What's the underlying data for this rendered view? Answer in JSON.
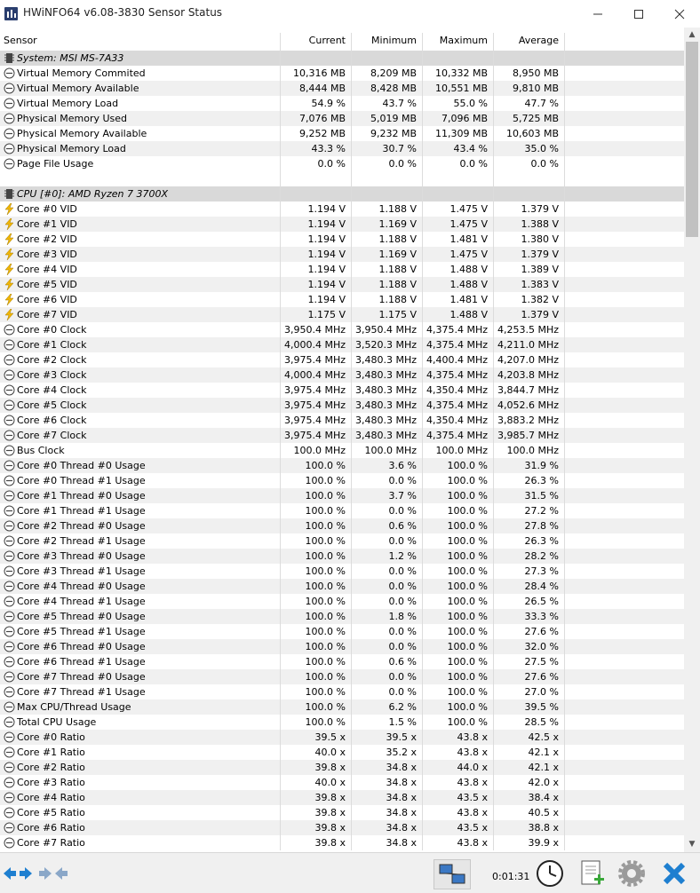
{
  "window": {
    "title": "HWiNFO64 v6.08-3830 Sensor Status"
  },
  "columns": {
    "sensor": "Sensor",
    "current": "Current",
    "minimum": "Minimum",
    "maximum": "Maximum",
    "average": "Average"
  },
  "rows": [
    {
      "type": "group",
      "name": "System: MSI MS-7A33"
    },
    {
      "type": "sensor",
      "icon": "gauge",
      "name": "Virtual Memory Commited",
      "cur": "10,316 MB",
      "min": "8,209 MB",
      "max": "10,332 MB",
      "avg": "8,950 MB"
    },
    {
      "type": "sensor",
      "icon": "gauge",
      "name": "Virtual Memory Available",
      "cur": "8,444 MB",
      "min": "8,428 MB",
      "max": "10,551 MB",
      "avg": "9,810 MB"
    },
    {
      "type": "sensor",
      "icon": "gauge",
      "name": "Virtual Memory Load",
      "cur": "54.9 %",
      "min": "43.7 %",
      "max": "55.0 %",
      "avg": "47.7 %"
    },
    {
      "type": "sensor",
      "icon": "gauge",
      "name": "Physical Memory Used",
      "cur": "7,076 MB",
      "min": "5,019 MB",
      "max": "7,096 MB",
      "avg": "5,725 MB"
    },
    {
      "type": "sensor",
      "icon": "gauge",
      "name": "Physical Memory Available",
      "cur": "9,252 MB",
      "min": "9,232 MB",
      "max": "11,309 MB",
      "avg": "10,603 MB"
    },
    {
      "type": "sensor",
      "icon": "gauge",
      "name": "Physical Memory Load",
      "cur": "43.3 %",
      "min": "30.7 %",
      "max": "43.4 %",
      "avg": "35.0 %"
    },
    {
      "type": "sensor",
      "icon": "gauge",
      "name": "Page File Usage",
      "cur": "0.0 %",
      "min": "0.0 %",
      "max": "0.0 %",
      "avg": "0.0 %"
    },
    {
      "type": "blank"
    },
    {
      "type": "group",
      "name": "CPU [#0]: AMD Ryzen 7 3700X"
    },
    {
      "type": "sensor",
      "icon": "bolt",
      "name": "Core #0 VID",
      "cur": "1.194 V",
      "min": "1.188 V",
      "max": "1.475 V",
      "avg": "1.379 V"
    },
    {
      "type": "sensor",
      "icon": "bolt",
      "name": "Core #1 VID",
      "cur": "1.194 V",
      "min": "1.169 V",
      "max": "1.475 V",
      "avg": "1.388 V"
    },
    {
      "type": "sensor",
      "icon": "bolt",
      "name": "Core #2 VID",
      "cur": "1.194 V",
      "min": "1.188 V",
      "max": "1.481 V",
      "avg": "1.380 V"
    },
    {
      "type": "sensor",
      "icon": "bolt",
      "name": "Core #3 VID",
      "cur": "1.194 V",
      "min": "1.169 V",
      "max": "1.475 V",
      "avg": "1.379 V"
    },
    {
      "type": "sensor",
      "icon": "bolt",
      "name": "Core #4 VID",
      "cur": "1.194 V",
      "min": "1.188 V",
      "max": "1.488 V",
      "avg": "1.389 V"
    },
    {
      "type": "sensor",
      "icon": "bolt",
      "name": "Core #5 VID",
      "cur": "1.194 V",
      "min": "1.188 V",
      "max": "1.488 V",
      "avg": "1.383 V"
    },
    {
      "type": "sensor",
      "icon": "bolt",
      "name": "Core #6 VID",
      "cur": "1.194 V",
      "min": "1.188 V",
      "max": "1.481 V",
      "avg": "1.382 V"
    },
    {
      "type": "sensor",
      "icon": "bolt",
      "name": "Core #7 VID",
      "cur": "1.175 V",
      "min": "1.175 V",
      "max": "1.488 V",
      "avg": "1.379 V"
    },
    {
      "type": "sensor",
      "icon": "gauge",
      "name": "Core #0 Clock",
      "cur": "3,950.4 MHz",
      "min": "3,950.4 MHz",
      "max": "4,375.4 MHz",
      "avg": "4,253.5 MHz"
    },
    {
      "type": "sensor",
      "icon": "gauge",
      "name": "Core #1 Clock",
      "cur": "4,000.4 MHz",
      "min": "3,520.3 MHz",
      "max": "4,375.4 MHz",
      "avg": "4,211.0 MHz"
    },
    {
      "type": "sensor",
      "icon": "gauge",
      "name": "Core #2 Clock",
      "cur": "3,975.4 MHz",
      "min": "3,480.3 MHz",
      "max": "4,400.4 MHz",
      "avg": "4,207.0 MHz"
    },
    {
      "type": "sensor",
      "icon": "gauge",
      "name": "Core #3 Clock",
      "cur": "4,000.4 MHz",
      "min": "3,480.3 MHz",
      "max": "4,375.4 MHz",
      "avg": "4,203.8 MHz"
    },
    {
      "type": "sensor",
      "icon": "gauge",
      "name": "Core #4 Clock",
      "cur": "3,975.4 MHz",
      "min": "3,480.3 MHz",
      "max": "4,350.4 MHz",
      "avg": "3,844.7 MHz"
    },
    {
      "type": "sensor",
      "icon": "gauge",
      "name": "Core #5 Clock",
      "cur": "3,975.4 MHz",
      "min": "3,480.3 MHz",
      "max": "4,375.4 MHz",
      "avg": "4,052.6 MHz"
    },
    {
      "type": "sensor",
      "icon": "gauge",
      "name": "Core #6 Clock",
      "cur": "3,975.4 MHz",
      "min": "3,480.3 MHz",
      "max": "4,350.4 MHz",
      "avg": "3,883.2 MHz"
    },
    {
      "type": "sensor",
      "icon": "gauge",
      "name": "Core #7 Clock",
      "cur": "3,975.4 MHz",
      "min": "3,480.3 MHz",
      "max": "4,375.4 MHz",
      "avg": "3,985.7 MHz"
    },
    {
      "type": "sensor",
      "icon": "gauge",
      "name": "Bus Clock",
      "cur": "100.0 MHz",
      "min": "100.0 MHz",
      "max": "100.0 MHz",
      "avg": "100.0 MHz"
    },
    {
      "type": "sensor",
      "icon": "gauge",
      "name": "Core #0 Thread #0 Usage",
      "cur": "100.0 %",
      "min": "3.6 %",
      "max": "100.0 %",
      "avg": "31.9 %"
    },
    {
      "type": "sensor",
      "icon": "gauge",
      "name": "Core #0 Thread #1 Usage",
      "cur": "100.0 %",
      "min": "0.0 %",
      "max": "100.0 %",
      "avg": "26.3 %"
    },
    {
      "type": "sensor",
      "icon": "gauge",
      "name": "Core #1 Thread #0 Usage",
      "cur": "100.0 %",
      "min": "3.7 %",
      "max": "100.0 %",
      "avg": "31.5 %"
    },
    {
      "type": "sensor",
      "icon": "gauge",
      "name": "Core #1 Thread #1 Usage",
      "cur": "100.0 %",
      "min": "0.0 %",
      "max": "100.0 %",
      "avg": "27.2 %"
    },
    {
      "type": "sensor",
      "icon": "gauge",
      "name": "Core #2 Thread #0 Usage",
      "cur": "100.0 %",
      "min": "0.6 %",
      "max": "100.0 %",
      "avg": "27.8 %"
    },
    {
      "type": "sensor",
      "icon": "gauge",
      "name": "Core #2 Thread #1 Usage",
      "cur": "100.0 %",
      "min": "0.0 %",
      "max": "100.0 %",
      "avg": "26.3 %"
    },
    {
      "type": "sensor",
      "icon": "gauge",
      "name": "Core #3 Thread #0 Usage",
      "cur": "100.0 %",
      "min": "1.2 %",
      "max": "100.0 %",
      "avg": "28.2 %"
    },
    {
      "type": "sensor",
      "icon": "gauge",
      "name": "Core #3 Thread #1 Usage",
      "cur": "100.0 %",
      "min": "0.0 %",
      "max": "100.0 %",
      "avg": "27.3 %"
    },
    {
      "type": "sensor",
      "icon": "gauge",
      "name": "Core #4 Thread #0 Usage",
      "cur": "100.0 %",
      "min": "0.0 %",
      "max": "100.0 %",
      "avg": "28.4 %"
    },
    {
      "type": "sensor",
      "icon": "gauge",
      "name": "Core #4 Thread #1 Usage",
      "cur": "100.0 %",
      "min": "0.0 %",
      "max": "100.0 %",
      "avg": "26.5 %"
    },
    {
      "type": "sensor",
      "icon": "gauge",
      "name": "Core #5 Thread #0 Usage",
      "cur": "100.0 %",
      "min": "1.8 %",
      "max": "100.0 %",
      "avg": "33.3 %"
    },
    {
      "type": "sensor",
      "icon": "gauge",
      "name": "Core #5 Thread #1 Usage",
      "cur": "100.0 %",
      "min": "0.0 %",
      "max": "100.0 %",
      "avg": "27.6 %"
    },
    {
      "type": "sensor",
      "icon": "gauge",
      "name": "Core #6 Thread #0 Usage",
      "cur": "100.0 %",
      "min": "0.0 %",
      "max": "100.0 %",
      "avg": "32.0 %"
    },
    {
      "type": "sensor",
      "icon": "gauge",
      "name": "Core #6 Thread #1 Usage",
      "cur": "100.0 %",
      "min": "0.6 %",
      "max": "100.0 %",
      "avg": "27.5 %"
    },
    {
      "type": "sensor",
      "icon": "gauge",
      "name": "Core #7 Thread #0 Usage",
      "cur": "100.0 %",
      "min": "0.0 %",
      "max": "100.0 %",
      "avg": "27.6 %"
    },
    {
      "type": "sensor",
      "icon": "gauge",
      "name": "Core #7 Thread #1 Usage",
      "cur": "100.0 %",
      "min": "0.0 %",
      "max": "100.0 %",
      "avg": "27.0 %"
    },
    {
      "type": "sensor",
      "icon": "gauge",
      "name": "Max CPU/Thread Usage",
      "cur": "100.0 %",
      "min": "6.2 %",
      "max": "100.0 %",
      "avg": "39.5 %"
    },
    {
      "type": "sensor",
      "icon": "gauge",
      "name": "Total CPU Usage",
      "cur": "100.0 %",
      "min": "1.5 %",
      "max": "100.0 %",
      "avg": "28.5 %"
    },
    {
      "type": "sensor",
      "icon": "gauge",
      "name": "Core #0 Ratio",
      "cur": "39.5 x",
      "min": "39.5 x",
      "max": "43.8 x",
      "avg": "42.5 x"
    },
    {
      "type": "sensor",
      "icon": "gauge",
      "name": "Core #1 Ratio",
      "cur": "40.0 x",
      "min": "35.2 x",
      "max": "43.8 x",
      "avg": "42.1 x"
    },
    {
      "type": "sensor",
      "icon": "gauge",
      "name": "Core #2 Ratio",
      "cur": "39.8 x",
      "min": "34.8 x",
      "max": "44.0 x",
      "avg": "42.1 x"
    },
    {
      "type": "sensor",
      "icon": "gauge",
      "name": "Core #3 Ratio",
      "cur": "40.0 x",
      "min": "34.8 x",
      "max": "43.8 x",
      "avg": "42.0 x"
    },
    {
      "type": "sensor",
      "icon": "gauge",
      "name": "Core #4 Ratio",
      "cur": "39.8 x",
      "min": "34.8 x",
      "max": "43.5 x",
      "avg": "38.4 x"
    },
    {
      "type": "sensor",
      "icon": "gauge",
      "name": "Core #5 Ratio",
      "cur": "39.8 x",
      "min": "34.8 x",
      "max": "43.8 x",
      "avg": "40.5 x"
    },
    {
      "type": "sensor",
      "icon": "gauge",
      "name": "Core #6 Ratio",
      "cur": "39.8 x",
      "min": "34.8 x",
      "max": "43.5 x",
      "avg": "38.8 x"
    },
    {
      "type": "sensor",
      "icon": "gauge",
      "name": "Core #7 Ratio",
      "cur": "39.8 x",
      "min": "34.8 x",
      "max": "43.8 x",
      "avg": "39.9 x"
    }
  ],
  "statusbar": {
    "elapsed": "0:01:31"
  },
  "colors": {
    "accent_blue": "#1e7fd0",
    "bolt": "#f2b705",
    "group_bg": "#d9d9d9",
    "alt_bg": "#f0f0f0"
  },
  "icons": [
    "app-icon",
    "gauge-icon",
    "bolt-icon",
    "chip-icon",
    "nav-left-right-icon",
    "collapse-icon",
    "network-icon",
    "clock-icon",
    "report-add-icon",
    "settings-gear-icon",
    "close-x-icon"
  ]
}
